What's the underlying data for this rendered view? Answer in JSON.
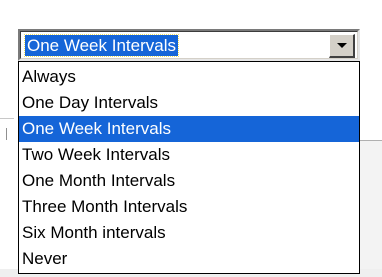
{
  "combo": {
    "value": "One Week Intervals",
    "button_icon": "chevron-down-icon"
  },
  "dropdown": {
    "selected_index": 2,
    "options": [
      "Always",
      "One Day Intervals",
      "One Week Intervals",
      "Two Week Intervals",
      "One Month Intervals",
      "Three Month Intervals",
      "Six Month intervals",
      "Never"
    ]
  },
  "colors": {
    "selection": "#1565d8",
    "selection_text": "#ffffff",
    "control_face": "#d4d0c8"
  }
}
